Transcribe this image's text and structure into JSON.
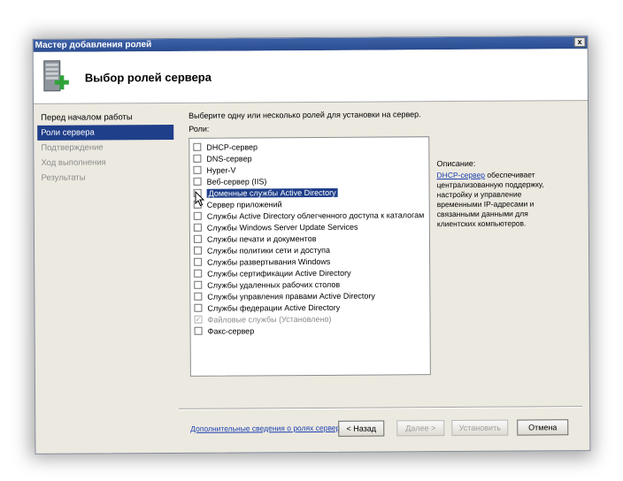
{
  "window": {
    "title": "Мастер добавления ролей",
    "close_label": "x"
  },
  "header": {
    "title": "Выбор ролей сервера",
    "icon": "server-add-icon"
  },
  "nav": {
    "items": [
      {
        "label": "Перед началом работы",
        "state": "normal"
      },
      {
        "label": "Роли сервера",
        "state": "active"
      },
      {
        "label": "Подтверждение",
        "state": "dim"
      },
      {
        "label": "Ход выполнения",
        "state": "dim"
      },
      {
        "label": "Результаты",
        "state": "dim"
      }
    ]
  },
  "content": {
    "instruction": "Выберите одну или несколько ролей для установки на сервер.",
    "roles_label": "Роли:",
    "roles": [
      {
        "label": "DHCP-сервер",
        "checked": false
      },
      {
        "label": "DNS-сервер",
        "checked": false
      },
      {
        "label": "Hyper-V",
        "checked": false
      },
      {
        "label": "Веб-сервер (IIS)",
        "checked": false
      },
      {
        "label": "Доменные службы Active Directory",
        "checked": false,
        "highlighted": true
      },
      {
        "label": "Сервер приложений",
        "checked": false
      },
      {
        "label": "Службы Active Directory облегченного доступа к каталогам",
        "checked": false
      },
      {
        "label": "Службы Windows Server Update Services",
        "checked": false
      },
      {
        "label": "Службы печати и документов",
        "checked": false
      },
      {
        "label": "Службы политики сети и доступа",
        "checked": false
      },
      {
        "label": "Службы развертывания Windows",
        "checked": false
      },
      {
        "label": "Службы сертификации Active Directory",
        "checked": false
      },
      {
        "label": "Службы удаленных рабочих столов",
        "checked": false
      },
      {
        "label": "Службы управления правами Active Directory",
        "checked": false
      },
      {
        "label": "Службы федерации Active Directory",
        "checked": false
      },
      {
        "label": "Файловые службы  (Установлено)",
        "checked": true,
        "disabled": true
      },
      {
        "label": "Факс-сервер",
        "checked": false
      }
    ],
    "description_label": "Описание:",
    "description_link": "DHCP-сервер",
    "description_text": " обеспечивает централизованную поддержку, настройку и управление временными IP-адресами и связанными данными для клиентских компьютеров.",
    "more_link": "Дополнительные сведения о ролях сервера"
  },
  "buttons": {
    "back": "< Назад",
    "next": "Далее >",
    "install": "Установить",
    "cancel": "Отмена"
  },
  "colors": {
    "selection": "#1f3f8a",
    "titlebar": "#2a4c90",
    "link": "#1a3fb0"
  }
}
